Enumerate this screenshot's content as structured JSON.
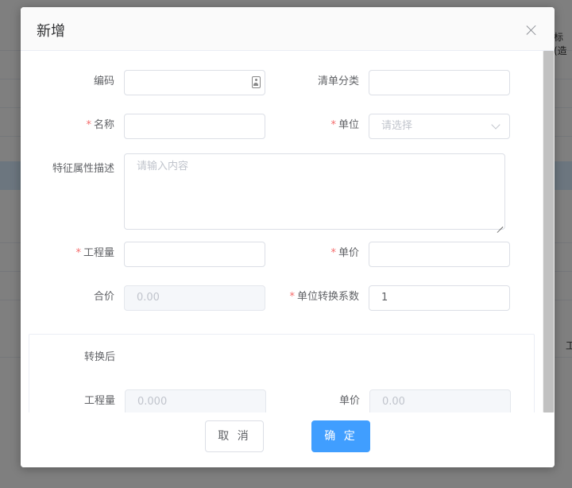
{
  "background": {
    "fragments": [
      "标(造",
      "工"
    ]
  },
  "dialog": {
    "title": "新增",
    "fields": {
      "code": {
        "label": "编码",
        "value": ""
      },
      "category": {
        "label": "清单分类",
        "value": ""
      },
      "name": {
        "label": "名称",
        "required_mark": "*",
        "value": ""
      },
      "unit": {
        "label": "单位",
        "required_mark": "*",
        "placeholder": "请选择"
      },
      "description": {
        "label": "特征属性描述",
        "placeholder": "请输入内容"
      },
      "quantity": {
        "label": "工程量",
        "required_mark": "*",
        "value": ""
      },
      "unit_price": {
        "label": "单价",
        "required_mark": "*",
        "value": ""
      },
      "total_price": {
        "label": "合价",
        "value": "0.00"
      },
      "conversion_factor": {
        "label": "单位转换系数",
        "required_mark": "*",
        "value": "1"
      }
    },
    "converted": {
      "section_label": "转换后",
      "quantity": {
        "label": "工程量",
        "value": "0.000"
      },
      "unit_price": {
        "label": "单价",
        "value": "0.00"
      }
    },
    "footer": {
      "cancel_label": "取 消",
      "confirm_label": "确 定"
    }
  },
  "colors": {
    "primary": "#409eff",
    "required": "#f56c6c"
  }
}
